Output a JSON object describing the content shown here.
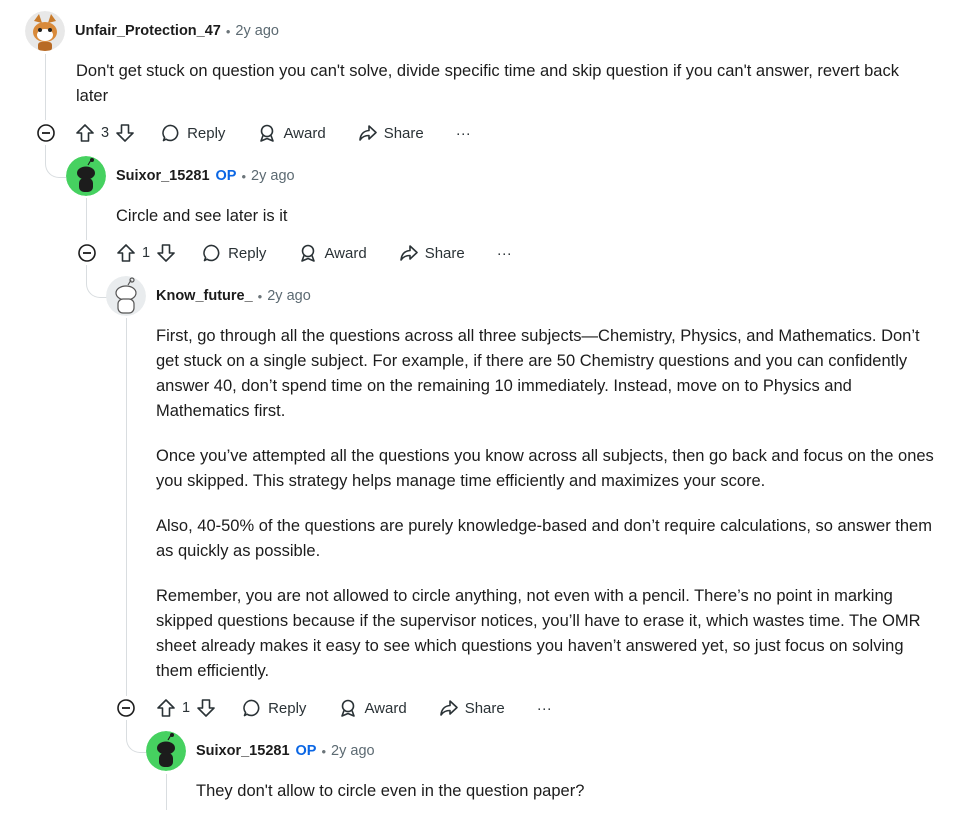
{
  "comments": [
    {
      "username": "Unfair_Protection_47",
      "op": "",
      "separator": "•",
      "time": "2y ago",
      "body": [
        "Don't get stuck on question you can't solve, divide specific time and skip question if you can't answer, revert back later"
      ],
      "votes": "3",
      "avatar_icon": "cat-snoo-avatar-icon"
    },
    {
      "username": "Suixor_15281",
      "op": "OP",
      "separator": "•",
      "time": "2y ago",
      "body": [
        "Circle and see later is it"
      ],
      "votes": "1",
      "avatar_icon": "green-snoo-avatar-icon"
    },
    {
      "username": "Know_future_",
      "op": "",
      "separator": "•",
      "time": "2y ago",
      "body": [
        "First, go through all the questions across all three subjects—Chemistry, Physics, and Mathematics. Don’t get stuck on a single subject. For example, if there are 50 Chemistry questions and you can confidently answer 40, don’t spend time on the remaining 10 immediately. Instead, move on to Physics and Mathematics first.",
        "Once you’ve attempted all the questions you know across all subjects, then go back and focus on the ones you skipped. This strategy helps manage time efficiently and maximizes your score.",
        "Also, 40-50% of the questions are purely knowledge-based and don’t require calculations, so answer them as quickly as possible.",
        "Remember, you are not allowed to circle anything, not even with a pencil. There’s no point in marking skipped questions because if the supervisor notices, you’ll have to erase it, which wastes time. The OMR sheet already makes it easy to see which questions you haven’t answered yet, so just focus on solving them efficiently."
      ],
      "votes": "1",
      "avatar_icon": "default-snoo-avatar-icon"
    },
    {
      "username": "Suixor_15281",
      "op": "OP",
      "separator": "•",
      "time": "2y ago",
      "body": [
        "They don't allow to circle even in the question paper?"
      ],
      "avatar_icon": "green-snoo-avatar-icon"
    }
  ],
  "actions": {
    "reply": "Reply",
    "award": "Award",
    "share": "Share",
    "more": "···"
  },
  "colors": {
    "op_badge": "#0a66e4",
    "thread_line": "#d9dde0",
    "green_avatar": "#46d160"
  }
}
